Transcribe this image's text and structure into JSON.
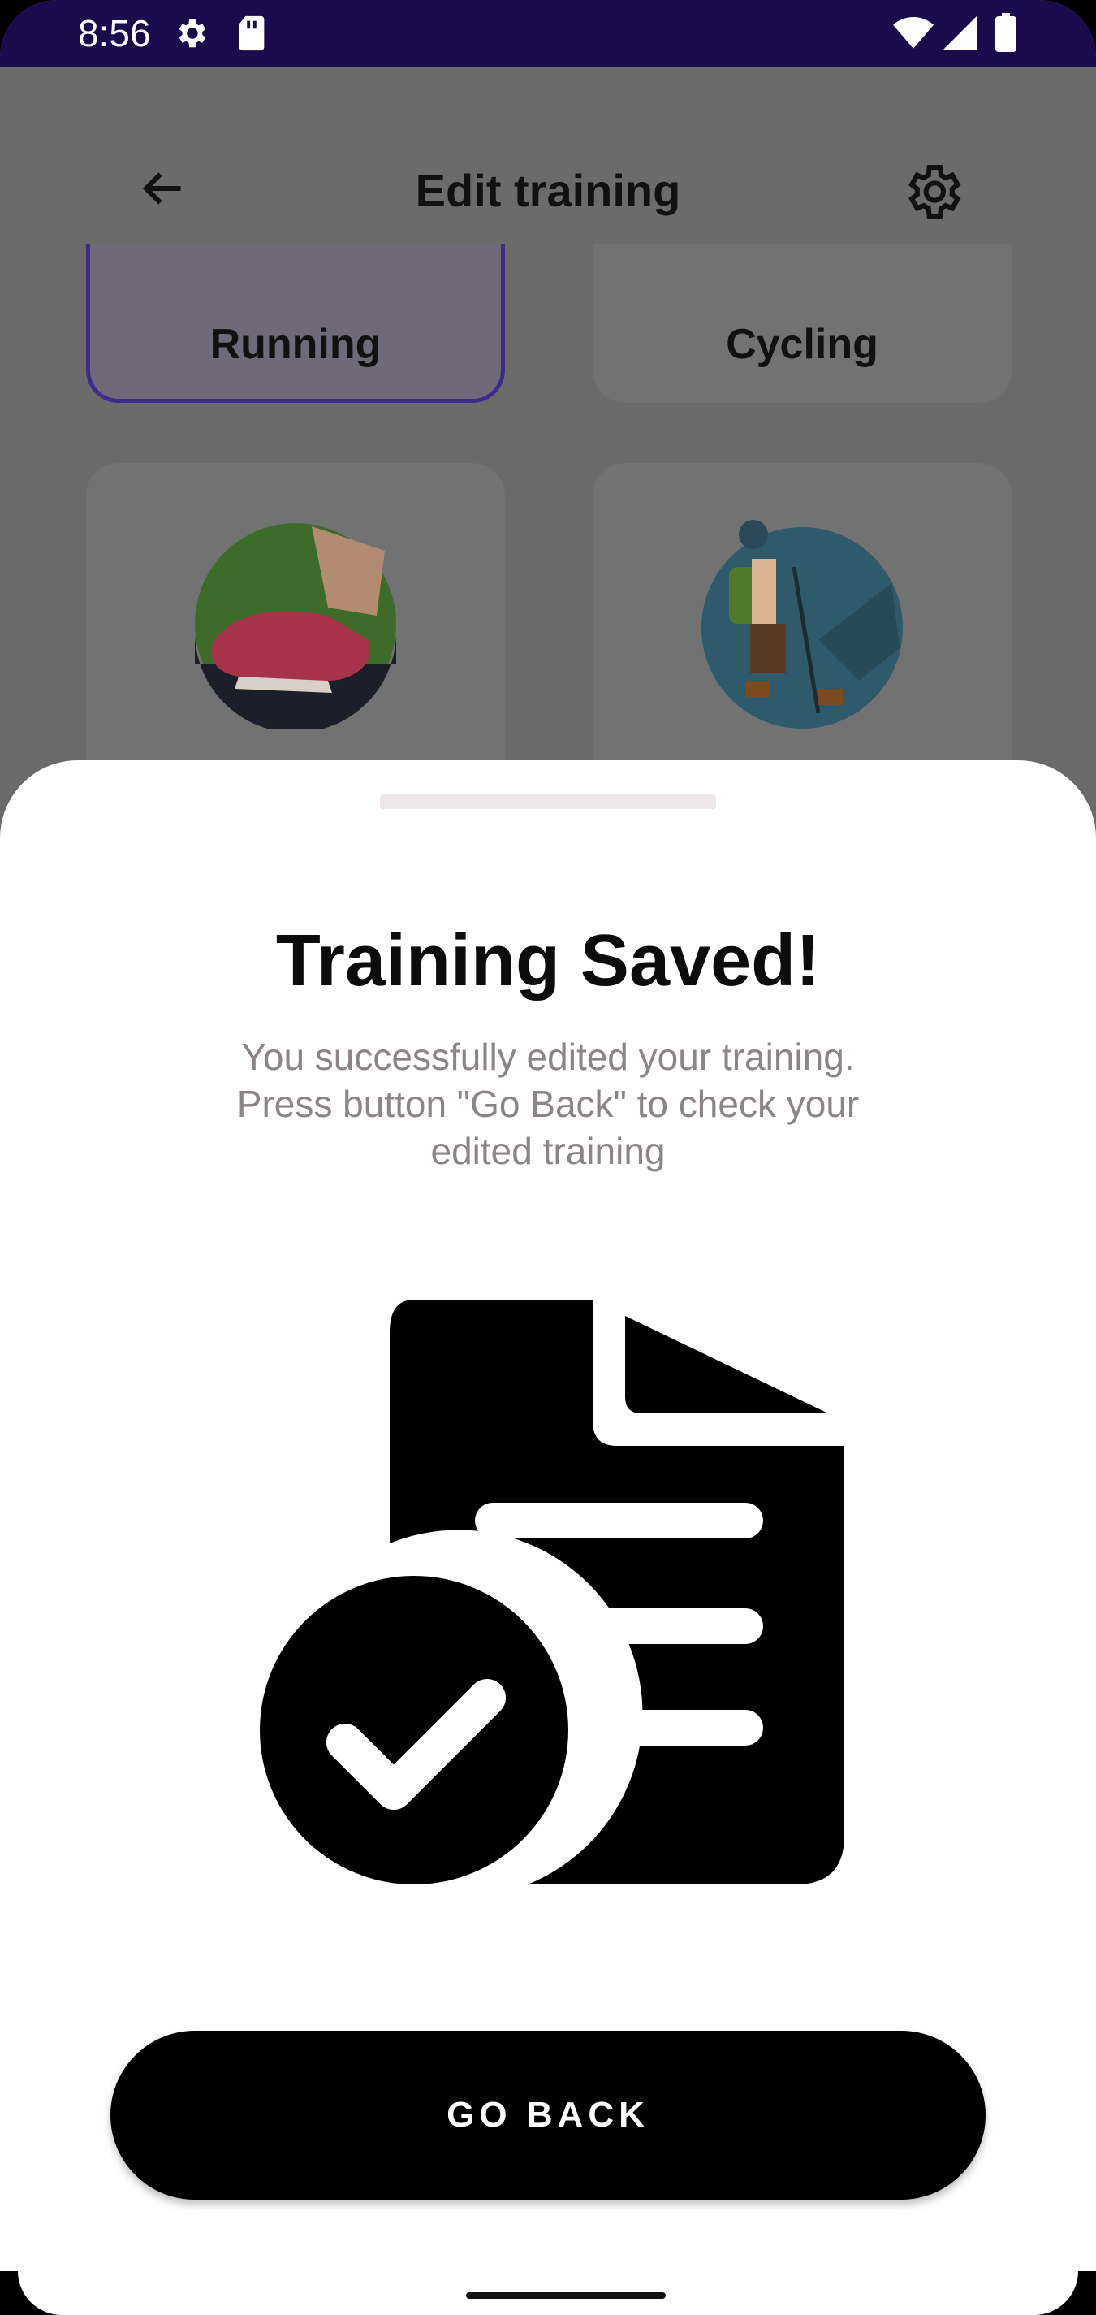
{
  "status_bar": {
    "time": "8:56",
    "icons": [
      "gear-icon",
      "sd-card-icon",
      "wifi-icon",
      "signal-icon",
      "battery-icon"
    ]
  },
  "header": {
    "title": "Edit training",
    "back_icon": "arrow-left-icon",
    "settings_icon": "gear-icon"
  },
  "activity_tiles": [
    {
      "label": "Running",
      "selected": true
    },
    {
      "label": "Cycling",
      "selected": false
    }
  ],
  "activity_images": [
    "running-shoe-image",
    "hiker-image"
  ],
  "sheet": {
    "title": "Training Saved!",
    "message_lines": [
      "You successfully edited your training.",
      "Press button \"Go Back\" to check your",
      "edited training"
    ],
    "illustration": "document-check-icon",
    "button_label": "GO BACK"
  },
  "colors": {
    "status_bar": "#1a0b4d",
    "selected_border": "#3f2c8a",
    "button": "#000000",
    "message_text": "#8b8589"
  }
}
